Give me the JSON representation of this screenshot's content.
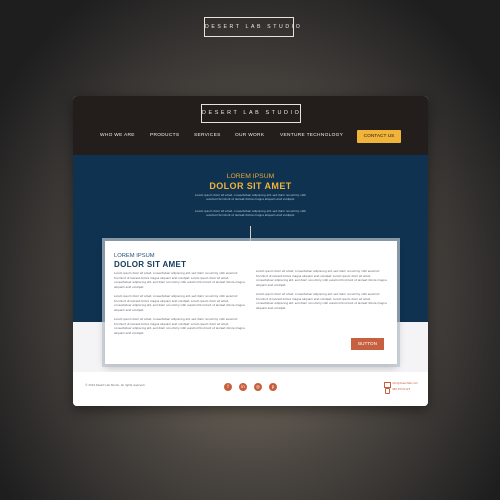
{
  "brand": {
    "logo_text": "DESERT LAB STUDIO"
  },
  "nav": {
    "items": [
      "WHO WE ARE",
      "PRODUCTS",
      "SERVICES",
      "OUR WORK",
      "VENTURE TECHNOLOGY"
    ],
    "cta_label": "CONTACT US"
  },
  "hero": {
    "subtitle": "LOREM IPSUM",
    "title": "DOLOR SIT AMET",
    "paragraphs": [
      "Lorem ipsum dolor sit amet, consectetuer adipiscing elit, sed diam nonummy nibh euismod tincidunt ut laoreet dolore magna aliquam erat volutpat.",
      "Lorem ipsum dolor sit amet, consectetuer adipiscing elit, sed diam nonummy nibh euismod tincidunt ut laoreet dolore magna aliquam erat volutpat."
    ]
  },
  "card": {
    "subtitle": "LOREM IPSUM",
    "title": "DOLOR SIT AMET",
    "left_paragraphs": [
      "Lorem ipsum dolor sit amet, consectetuer adipiscing elit, sed diam nonummy nibh euismod tincidunt ut laoreet dolore magna aliquam erat volutpat. Lorem ipsum dolor sit amet, consectetuer adipiscing elit, sed diam nonummy nibh euismod tincidunt ut laoreet dolore magna aliquam erat volutpat.",
      "Lorem ipsum dolor sit amet, consectetuer adipiscing elit, sed diam nonummy nibh euismod tincidunt ut laoreet dolore magna aliquam erat volutpat. Lorem ipsum dolor sit amet, consectetuer adipiscing elit, sed diam nonummy nibh euismod tincidunt ut laoreet dolore magna aliquam erat volutpat.",
      "Lorem ipsum dolor sit amet, consectetuer adipiscing elit, sed diam nonummy nibh euismod tincidunt ut laoreet dolore magna aliquam erat volutpat. Lorem ipsum dolor sit amet, consectetuer adipiscing elit, sed diam nonummy nibh euismod tincidunt ut laoreet dolore magna aliquam erat volutpat."
    ],
    "right_paragraphs": [
      "Lorem ipsum dolor sit amet, consectetuer adipiscing elit, sed diam nonummy nibh euismod tincidunt ut laoreet dolore magna aliquam erat volutpat. Lorem ipsum dolor sit amet, consectetuer adipiscing elit, sed diam nonummy nibh euismod tincidunt ut laoreet dolore magna aliquam erat volutpat.",
      "Lorem ipsum dolor sit amet, consectetuer adipiscing elit, sed diam nonummy nibh euismod tincidunt ut laoreet dolore magna aliquam erat volutpat. Lorem ipsum dolor sit amet, consectetuer adipiscing elit, sed diam nonummy nibh euismod tincidunt ut laoreet dolore magna aliquam erat volutpat."
    ],
    "button_label": "BUTTON"
  },
  "footer": {
    "copyright": "© 2019 Desert Lab Studio, All rights reserved.",
    "social_icons": [
      "facebook-icon",
      "linkedin-icon",
      "instagram-icon",
      "pinterest-icon"
    ],
    "email": "info@desertlab.com",
    "phone": "480.555.0123"
  },
  "colors": {
    "header_bg": "#231e1c",
    "hero_bg": "#0e3250",
    "accent_gold": "#f1b43b",
    "accent_rust": "#c6603f",
    "title_navy": "#123a5c"
  }
}
